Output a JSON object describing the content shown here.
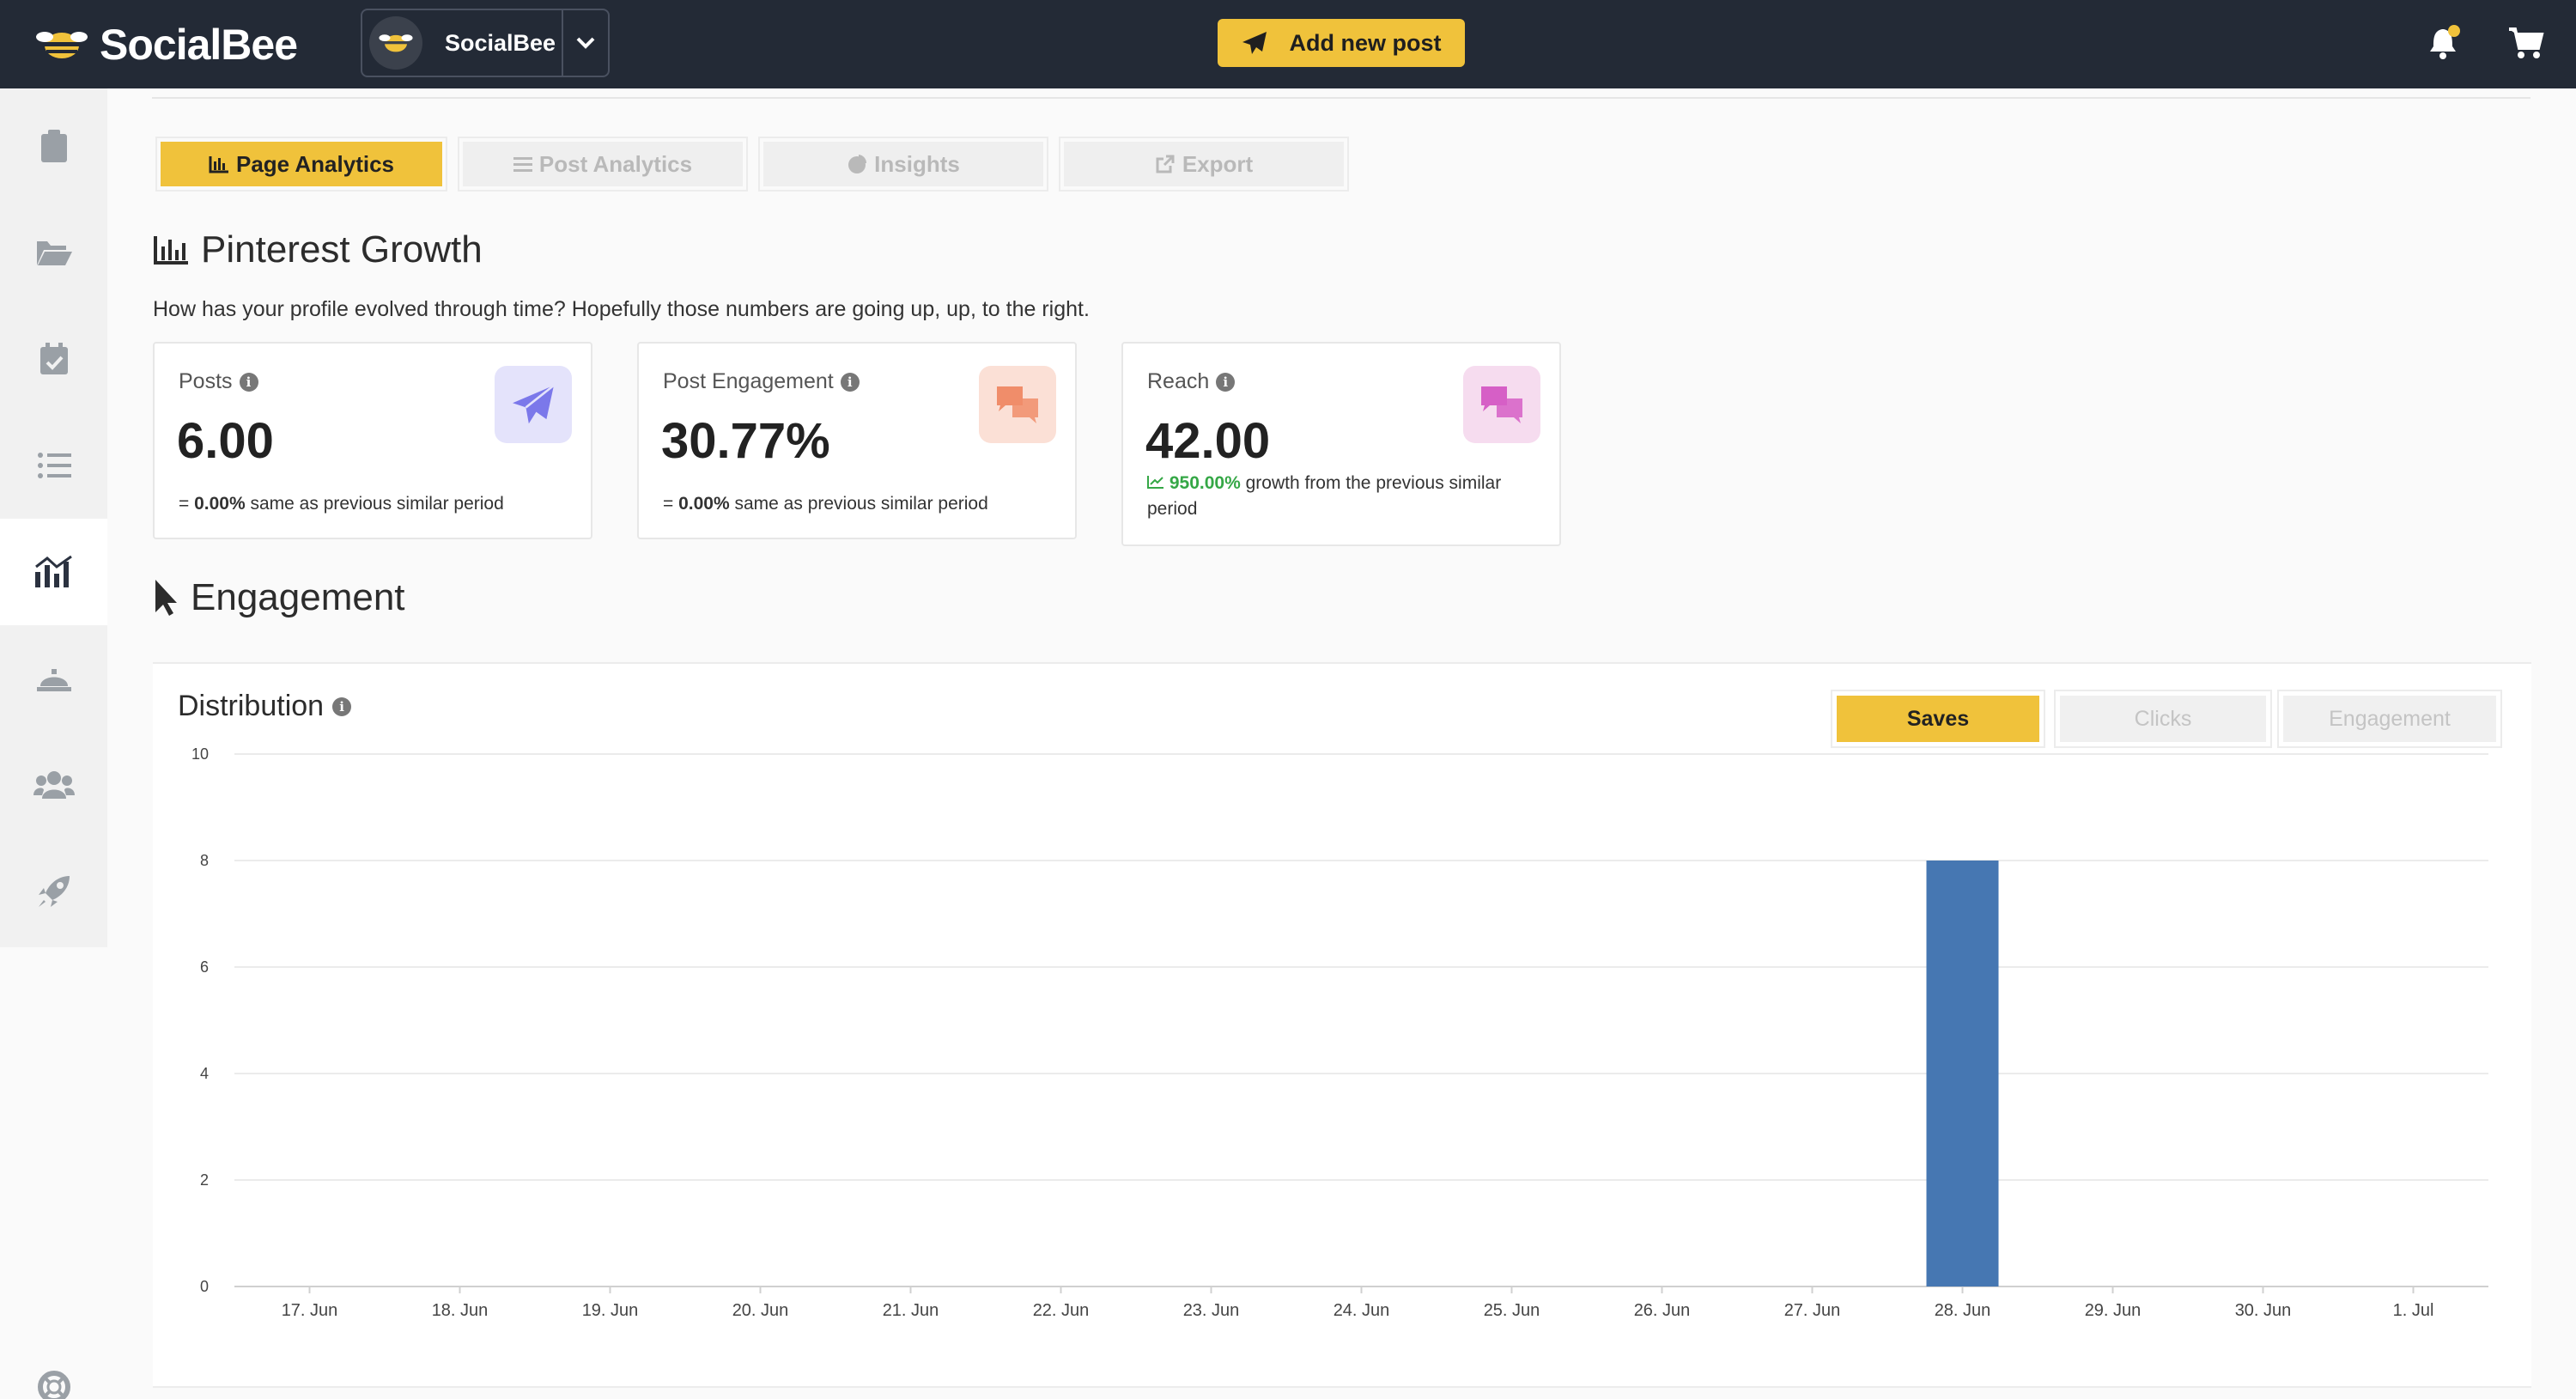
{
  "app": {
    "brand": "SocialBee",
    "account_name": "SocialBee",
    "add_post_label": "Add new post",
    "colors": {
      "topbar": "#232a36",
      "accent": "#f0c23b",
      "bar": "#4677b2"
    }
  },
  "sidebar": {
    "items": [
      {
        "icon": "clipboard-icon",
        "active": false
      },
      {
        "icon": "folder-open-icon",
        "active": false
      },
      {
        "icon": "calendar-check-icon",
        "active": false
      },
      {
        "icon": "list-icon",
        "active": false
      },
      {
        "icon": "analytics-chart-icon",
        "active": true
      },
      {
        "icon": "concierge-bell-icon",
        "active": false
      },
      {
        "icon": "users-icon",
        "active": false
      },
      {
        "icon": "rocket-icon",
        "active": false
      }
    ],
    "help_icon": "lifebuoy-icon"
  },
  "tabs": [
    {
      "label": "Page Analytics",
      "icon": "bar-chart-icon",
      "active": true
    },
    {
      "label": "Post Analytics",
      "icon": "list-icon",
      "active": false
    },
    {
      "label": "Insights",
      "icon": "pie-chart-icon",
      "active": false
    },
    {
      "label": "Export",
      "icon": "external-link-icon",
      "active": false
    }
  ],
  "growth": {
    "title": "Pinterest Growth",
    "subtitle": "How has your profile evolved through time? Hopefully those numbers are going up, up, to the right.",
    "cards": [
      {
        "label": "Posts",
        "value": "6.00",
        "delta": "0.00%",
        "note": "same as previous similar period",
        "trend": "equal",
        "icon": "paper-plane-icon",
        "icon_bg": "#e4e3fb",
        "icon_color": "#7b78ea"
      },
      {
        "label": "Post Engagement",
        "value": "30.77%",
        "delta": "0.00%",
        "note": "same as previous similar period",
        "trend": "equal",
        "icon": "comments-icon",
        "icon_bg": "#fbe0d6",
        "icon_color": "#f08d6a"
      },
      {
        "label": "Reach",
        "value": "42.00",
        "delta": "950.00%",
        "note": "growth from the previous similar period",
        "trend": "up",
        "icon": "comments-icon",
        "icon_bg": "#f6dcef",
        "icon_color": "#d65fc6"
      }
    ]
  },
  "engagement": {
    "title": "Engagement",
    "distribution_title": "Distribution",
    "metric_buttons": [
      {
        "label": "Saves",
        "active": true
      },
      {
        "label": "Clicks",
        "active": false
      },
      {
        "label": "Engagement",
        "active": false
      }
    ]
  },
  "chart_data": {
    "type": "bar",
    "categories": [
      "17. Jun",
      "18. Jun",
      "19. Jun",
      "20. Jun",
      "21. Jun",
      "22. Jun",
      "23. Jun",
      "24. Jun",
      "25. Jun",
      "26. Jun",
      "27. Jun",
      "28. Jun",
      "29. Jun",
      "30. Jun",
      "1. Jul"
    ],
    "values": [
      0,
      0,
      0,
      0,
      0,
      0,
      0,
      0,
      0,
      0,
      0,
      8,
      0,
      0,
      0
    ],
    "ylim": [
      0,
      10
    ],
    "yticks": [
      0,
      2,
      4,
      6,
      8,
      10
    ],
    "grid": true,
    "legend": "none"
  }
}
